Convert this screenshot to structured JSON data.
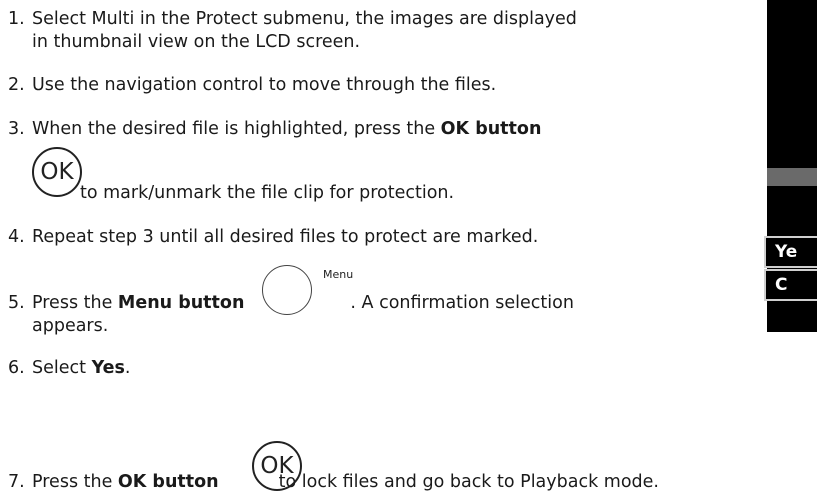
{
  "steps": [
    {
      "num": "1.",
      "line1": "Select Multi in the Protect submenu, the images are displayed",
      "line2": "in thumbnail view on the LCD screen."
    },
    {
      "num": "2.",
      "line1": "Use the navigation control to move through the files."
    },
    {
      "num": "3.",
      "pre": "When the desired file is highlighted, press the ",
      "bold": "OK button",
      "line2": "to mark/unmark the file clip for protection."
    },
    {
      "num": "4.",
      "line1": "Repeat step 3 until all desired files to protect are marked."
    },
    {
      "num": "5.",
      "pre": "Press the ",
      "bold": "Menu button",
      "post": ". A confirmation selection",
      "line2": "appears."
    },
    {
      "num": "6.",
      "pre": "Select ",
      "bold": "Yes",
      "post": "."
    },
    {
      "num": "7.",
      "pre": "Press the ",
      "bold": "OK button",
      "post": "to lock files and go back to Playback mode."
    }
  ],
  "icons": {
    "ok": "OK",
    "menu": "Menu"
  },
  "lcd": {
    "yes": "Ye",
    "cancel": "C"
  }
}
